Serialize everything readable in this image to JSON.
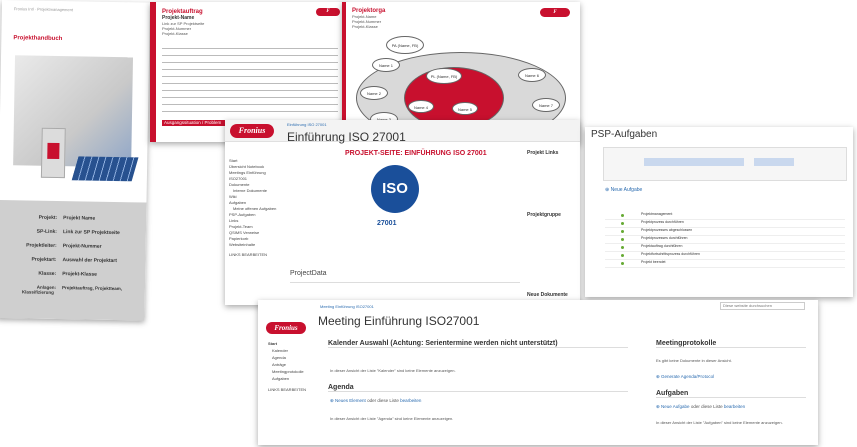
{
  "doc1": {
    "title": "Projekthandbuch",
    "rows": [
      {
        "key": "Projekt:",
        "val": "Projekt Name"
      },
      {
        "key": "SP-Link:",
        "val": "Link zur SP Projektseite"
      },
      {
        "key": "Projektleiter:",
        "val": "Projekt-Nummer"
      },
      {
        "key": "Projektart:",
        "val": "Auswahl der Projektart"
      },
      {
        "key": "Klasse:",
        "val": "Projekt-Klasse"
      },
      {
        "key": "Anlagen:",
        "val": "Projektauftrag, Projektteam, Klassifizierung"
      }
    ]
  },
  "doc2": {
    "title": "Projektauftrag",
    "lines": [
      "Projekt-Name",
      "Link zur SP Projektseite",
      "Projekt-Nummer",
      "Projekt-Klasse"
    ],
    "section": "Ausgangssituation / Problem"
  },
  "doc3": {
    "title": "Projektorga",
    "lines": [
      "Projekt-Name",
      "Projekt-Nummer",
      "Projekt-Klasse"
    ],
    "nodes": [
      "PA (Name, FB)",
      "PL (Name, FB)",
      "Name 1",
      "Name 2",
      "Name 3",
      "Name 4",
      "Name 5",
      "Name 6",
      "Name 7",
      "Name 8"
    ]
  },
  "win1": {
    "brand": "Fronius",
    "breadcrumb": "Einführung ISO 27001",
    "page_title": "Einführung ISO 27001",
    "headline": "PROJEKT-SEITE: EINFÜHRUNG ISO 27001",
    "iso_word": "ISO",
    "iso_number": "27001",
    "nav": [
      "Start",
      "Übersicht Notebook",
      "Meetings Einführung ISO27001",
      "Dokumente",
      "Interne Dokumente",
      "Wiki",
      "Aufgaben",
      "Meine offenen Aufgaben",
      "PSP-Aufgaben",
      "Links",
      "Projekt-Team",
      "QSIMS Verweise",
      "Papierkorb",
      "Websiteinhalte"
    ],
    "edit_links": "LINKS BEARBEITEN",
    "project_data": "ProjectData",
    "project_links": "Projekt Links",
    "project_group": "Projektgruppe",
    "new_docs": "Neue Dokumente"
  },
  "win2": {
    "title": "PSP-Aufgaben",
    "new_task": "Neue Aufgabe",
    "rows": [
      "Projektmanagement",
      "Projektprozess durchführen",
      "Projektprozesses abgeschlossen",
      "Projektprozesses durchführen",
      "Projektauftrag durchführen",
      "Projektfortschrittsprozess durchführen",
      "Projekt beendet"
    ]
  },
  "win3": {
    "brand": "Fronius",
    "breadcrumb": "Meeting Einführung ISO27001",
    "page_title": "Meeting Einführung ISO27001",
    "search_placeholder": "Diese website durchsuchen",
    "nav": [
      "Start",
      "Kalender",
      "Agenda",
      "Anträge",
      "Meetingprotokolle",
      "Aufgaben"
    ],
    "edit_links": "LINKS BEARBEITEN",
    "calendar_header": "Kalender Auswahl (Achtung: Serientermine werden nicht unterstützt)",
    "calendar_empty": "In dieser Ansicht der Liste \"Kalender\" sind keine Elemente anzuzeigen.",
    "agenda_header": "Agenda",
    "agenda_new": "Neues Element",
    "agenda_or": "oder diese Liste",
    "agenda_edit": "bearbeiten",
    "agenda_empty": "In dieser Ansicht der Liste \"Agenda\" sind keine Elemente anzuzeigen.",
    "protocols_header": "Meetingprotokolle",
    "protocols_empty": "Es gibt keine Dokumente in dieser Ansicht.",
    "generate_agenda": "Generate Agenda/Protocol",
    "tasks_header": "Aufgaben",
    "tasks_new": "Neue Aufgabe",
    "tasks_or": "oder diese Liste",
    "tasks_edit": "bearbeiten",
    "tasks_empty": "In dieser Ansicht der Liste \"Aufgaben\" sind keine Elemente anzuzeigen."
  }
}
